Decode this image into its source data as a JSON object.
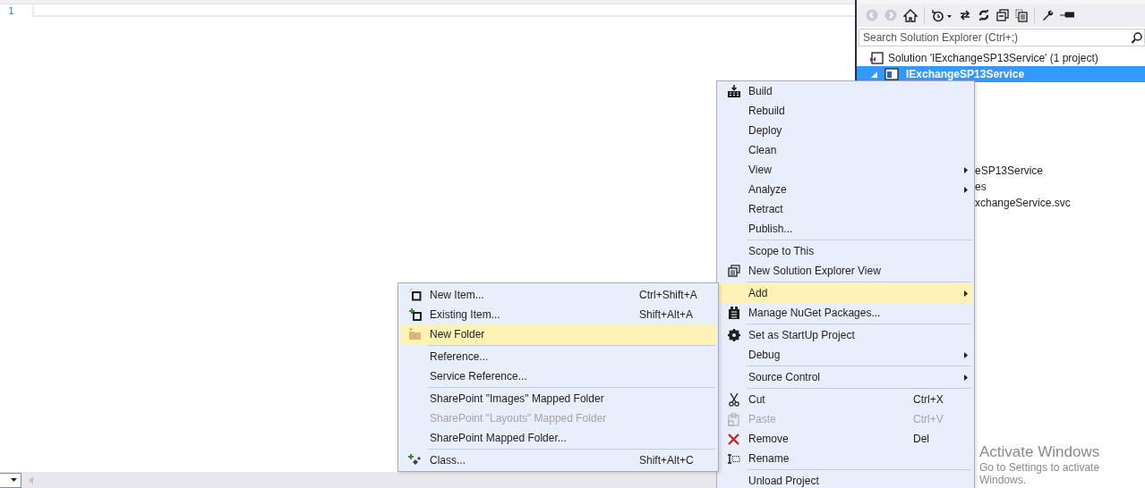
{
  "editor": {
    "line_numbers": [
      "1"
    ]
  },
  "solution_explorer": {
    "search": {
      "placeholder": "Search Solution Explorer (Ctrl+;)"
    },
    "tree": [
      {
        "label": "Solution 'IExchangeSP13Service' (1 project)",
        "selected": false,
        "children": [
          {
            "label": "IExchangeSP13Service",
            "selected": true,
            "expanded": true,
            "children": [
              {
                "label": "eSP13Service",
                "selected": false
              },
              {
                "label": "es",
                "selected": false
              },
              {
                "label": "xchangeService.svc",
                "selected": false
              }
            ]
          }
        ]
      }
    ]
  },
  "context_menu": {
    "items": [
      {
        "kind": "item",
        "label": "Build",
        "selected": false,
        "disabled": false
      },
      {
        "kind": "item",
        "label": "Rebuild",
        "selected": false,
        "disabled": false
      },
      {
        "kind": "item",
        "label": "Deploy",
        "selected": false,
        "disabled": false
      },
      {
        "kind": "item",
        "label": "Clean",
        "selected": false,
        "disabled": false
      },
      {
        "kind": "item",
        "label": "View",
        "selected": false,
        "disabled": false,
        "submenu": true
      },
      {
        "kind": "item",
        "label": "Analyze",
        "selected": false,
        "disabled": false,
        "submenu": true
      },
      {
        "kind": "item",
        "label": "Retract",
        "selected": false,
        "disabled": false
      },
      {
        "kind": "item",
        "label": "Publish...",
        "selected": false,
        "disabled": false
      },
      {
        "kind": "separator"
      },
      {
        "kind": "item",
        "label": "Scope to This",
        "selected": false,
        "disabled": false
      },
      {
        "kind": "item",
        "label": "New Solution Explorer View",
        "selected": false,
        "disabled": false
      },
      {
        "kind": "separator"
      },
      {
        "kind": "item",
        "label": "Add",
        "selected": true,
        "disabled": false,
        "submenu": true
      },
      {
        "kind": "item",
        "label": "Manage NuGet Packages...",
        "selected": false,
        "disabled": false
      },
      {
        "kind": "separator"
      },
      {
        "kind": "item",
        "label": "Set as StartUp Project",
        "selected": false,
        "disabled": false
      },
      {
        "kind": "item",
        "label": "Debug",
        "selected": false,
        "disabled": false,
        "submenu": true
      },
      {
        "kind": "separator"
      },
      {
        "kind": "item",
        "label": "Source Control",
        "selected": false,
        "disabled": false,
        "submenu": true
      },
      {
        "kind": "separator"
      },
      {
        "kind": "item",
        "label": "Cut",
        "shortcut": "Ctrl+X",
        "selected": false,
        "disabled": false
      },
      {
        "kind": "item",
        "label": "Paste",
        "shortcut": "Ctrl+V",
        "selected": false,
        "disabled": true
      },
      {
        "kind": "item",
        "label": "Remove",
        "shortcut": "Del",
        "selected": false,
        "disabled": false
      },
      {
        "kind": "item",
        "label": "Rename",
        "selected": false,
        "disabled": false
      },
      {
        "kind": "separator"
      },
      {
        "kind": "item",
        "label": "Unload Project",
        "selected": false,
        "disabled": false
      }
    ]
  },
  "add_submenu": {
    "items": [
      {
        "kind": "item",
        "label": "New Item...",
        "shortcut": "Ctrl+Shift+A",
        "selected": false,
        "disabled": false
      },
      {
        "kind": "item",
        "label": "Existing Item...",
        "shortcut": "Shift+Alt+A",
        "selected": false,
        "disabled": false
      },
      {
        "kind": "item",
        "label": "New Folder",
        "selected": true,
        "disabled": false
      },
      {
        "kind": "separator"
      },
      {
        "kind": "item",
        "label": "Reference...",
        "selected": false,
        "disabled": false
      },
      {
        "kind": "item",
        "label": "Service Reference...",
        "selected": false,
        "disabled": false
      },
      {
        "kind": "separator"
      },
      {
        "kind": "item",
        "label": "SharePoint \"Images\" Mapped Folder",
        "selected": false,
        "disabled": false
      },
      {
        "kind": "item",
        "label": "SharePoint \"Layouts\" Mapped Folder",
        "selected": false,
        "disabled": true
      },
      {
        "kind": "item",
        "label": "SharePoint Mapped Folder...",
        "selected": false,
        "disabled": false
      },
      {
        "kind": "separator"
      },
      {
        "kind": "item",
        "label": "Class...",
        "shortcut": "Shift+Alt+C",
        "selected": false,
        "disabled": false
      }
    ]
  },
  "activation_notice": {
    "title": "Activate Windows",
    "text": "Go to Settings to activate Windows."
  }
}
